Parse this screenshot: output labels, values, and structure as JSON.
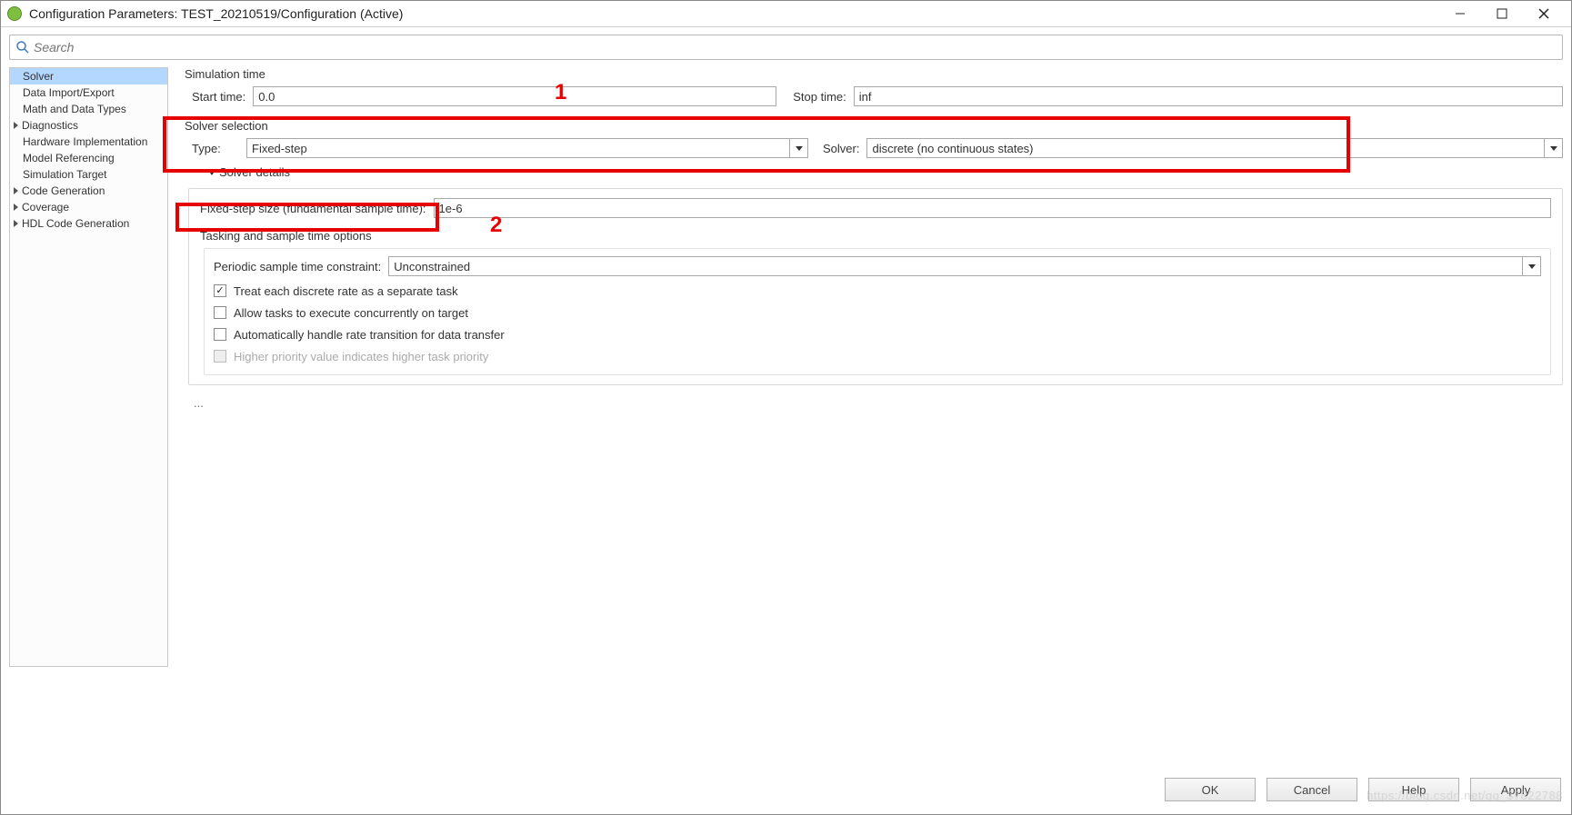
{
  "window": {
    "title": "Configuration Parameters: TEST_20210519/Configuration (Active)"
  },
  "search": {
    "placeholder": "Search"
  },
  "sidebar": {
    "items": [
      {
        "label": "Solver",
        "selected": true,
        "expandable": false
      },
      {
        "label": "Data Import/Export",
        "expandable": false
      },
      {
        "label": "Math and Data Types",
        "expandable": false
      },
      {
        "label": "Diagnostics",
        "expandable": true
      },
      {
        "label": "Hardware Implementation",
        "expandable": false
      },
      {
        "label": "Model Referencing",
        "expandable": false
      },
      {
        "label": "Simulation Target",
        "expandable": false
      },
      {
        "label": "Code Generation",
        "expandable": true
      },
      {
        "label": "Coverage",
        "expandable": true
      },
      {
        "label": "HDL Code Generation",
        "expandable": true
      }
    ]
  },
  "simulation_time": {
    "title": "Simulation time",
    "start_label": "Start time:",
    "start_value": "0.0",
    "stop_label": "Stop time:",
    "stop_value": "inf"
  },
  "solver_selection": {
    "title": "Solver selection",
    "type_label": "Type:",
    "type_value": "Fixed-step",
    "solver_label": "Solver:",
    "solver_value": "discrete (no continuous states)"
  },
  "solver_details": {
    "title": "Solver details",
    "step_label": "Fixed-step size (fundamental sample time):",
    "step_value": "1e-6",
    "tasking_title": "Tasking and sample time options",
    "periodic_label": "Periodic sample time constraint:",
    "periodic_value": "Unconstrained",
    "cb1": "Treat each discrete rate as a separate task",
    "cb2": "Allow tasks to execute concurrently on target",
    "cb3": "Automatically handle rate transition for data transfer",
    "cb4": "Higher priority value indicates higher task priority"
  },
  "annotations": {
    "a1": "1",
    "a2": "2"
  },
  "ellipsis": "...",
  "buttons": {
    "ok": "OK",
    "cancel": "Cancel",
    "help": "Help",
    "apply": "Apply"
  },
  "watermark": "https://blog.csdn.net/qq_37822788"
}
